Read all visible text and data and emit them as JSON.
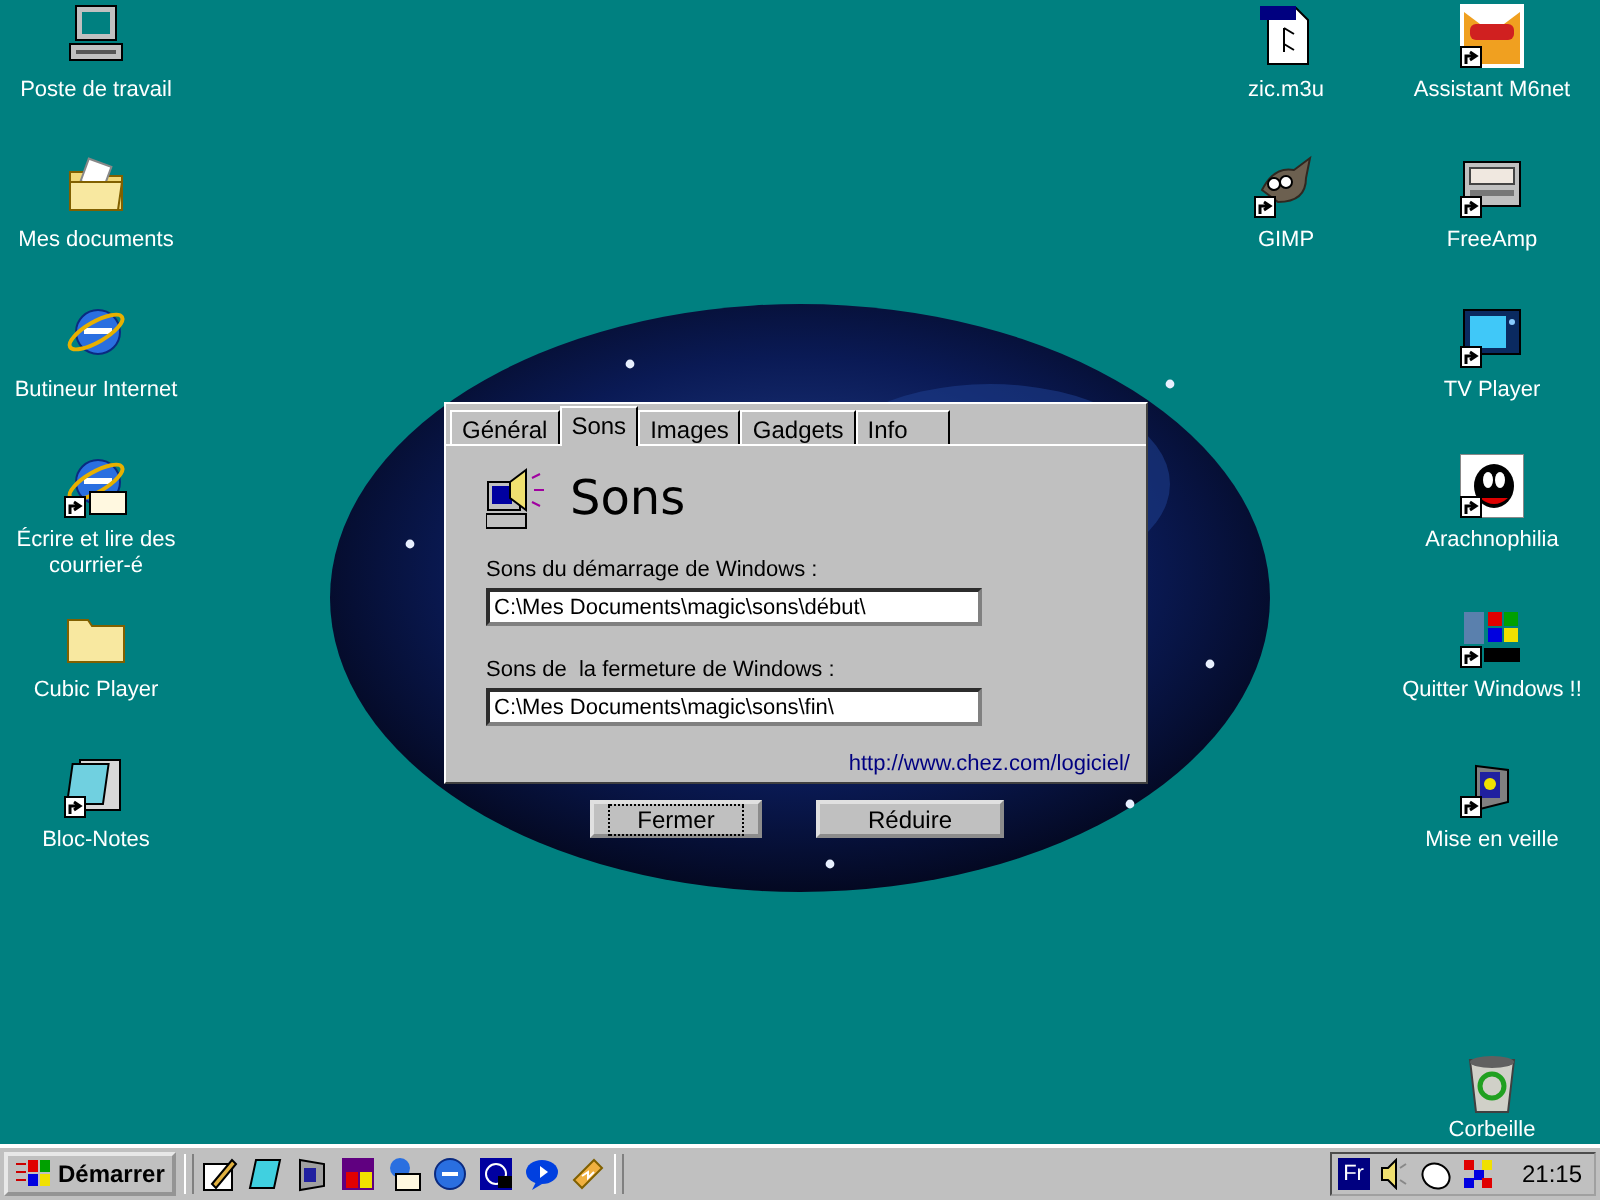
{
  "desktop": {
    "left_icons": [
      {
        "label": "Poste de travail",
        "shortcut": false
      },
      {
        "label": "Mes documents",
        "shortcut": false
      },
      {
        "label": "Butineur Internet",
        "shortcut": false
      },
      {
        "label": "Écrire et lire des courrier-é",
        "shortcut": true
      },
      {
        "label": "Cubic Player",
        "shortcut": false
      },
      {
        "label": "Bloc-Notes",
        "shortcut": true
      }
    ],
    "middle_icons": [
      {
        "label": "zic.m3u",
        "shortcut": false
      },
      {
        "label": "GIMP",
        "shortcut": true
      }
    ],
    "right_icons": [
      {
        "label": "Assistant M6net",
        "shortcut": true
      },
      {
        "label": "FreeAmp",
        "shortcut": true
      },
      {
        "label": "TV Player",
        "shortcut": true
      },
      {
        "label": "Arachnophilia",
        "shortcut": true
      },
      {
        "label": "Quitter Windows !!",
        "shortcut": true
      },
      {
        "label": "Mise en veille",
        "shortcut": true
      }
    ],
    "recycle_bin": {
      "label": "Corbeille"
    }
  },
  "dialog": {
    "tabs": [
      {
        "label": "Général",
        "selected": false
      },
      {
        "label": "Sons",
        "selected": true
      },
      {
        "label": "Images",
        "selected": false
      },
      {
        "label": "Gadgets",
        "selected": false
      },
      {
        "label": "Info",
        "selected": false
      }
    ],
    "title": "Sons",
    "fields": [
      {
        "label": "Sons du démarrage de Windows :",
        "value": "C:\\Mes Documents\\magic\\sons\\début\\"
      },
      {
        "label": "Sons de  la fermeture de Windows :",
        "value": "C:\\Mes Documents\\magic\\sons\\fin\\"
      }
    ],
    "link": "http://www.chez.com/logiciel/",
    "buttons": [
      {
        "label": "Fermer",
        "focused": true
      },
      {
        "label": "Réduire",
        "focused": false
      }
    ]
  },
  "taskbar": {
    "start": "Démarrer",
    "language": "Fr",
    "clock": "21:15"
  }
}
